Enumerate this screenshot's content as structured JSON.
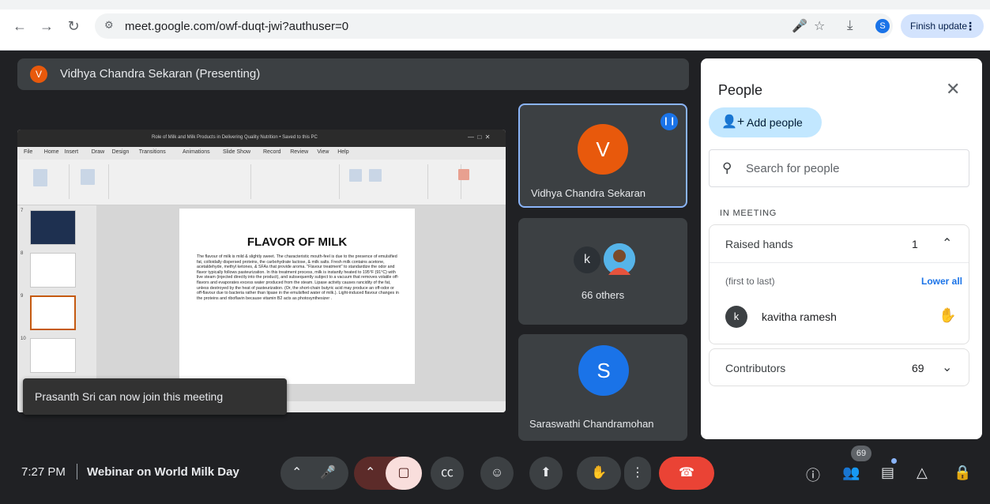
{
  "browser": {
    "url": "meet.google.com/owf-duqt-jwi?authuser=0",
    "finish_update": "Finish update",
    "profile_initial": "S"
  },
  "presenting_banner": {
    "initial": "V",
    "text": "Vidhya Chandra Sekaran (Presenting)"
  },
  "shared_screen": {
    "window_title": "Role of Milk and Milk Products in Delivering Quality Nutrition • Saved to this PC",
    "menu": [
      "File",
      "Home",
      "Insert",
      "Draw",
      "Design",
      "Transitions",
      "Animations",
      "Slide Show",
      "Record",
      "Review",
      "View",
      "Help"
    ],
    "slide_title": "FLAVOR OF MILK",
    "slide_body": "The flavour of milk is mild & slightly sweet. The characteristic mouth-feel is due to the presence of emulsified fat, colloidally dispersed proteins, the carbohydrate lactose, & milk salts. Fresh milk contains acetone, acetaldehyde, methyl ketones, & SFAs that provide aroma. \"Flavour treatment\" to standardize the odor and flavor typically follows pasteurization. In this treatment process, milk is instantly heated to 195°F (91°C) with live steam (injected directly into the product), and subsequently subject to a vacuum that removes volatile off- flavors and evaporates excess water produced from the steam. Lipase activity causes rancidity of the fat, unless destroyed by the heat of pasteurization. (Or, the short-chain butyric acid may produce an off-odor or off-flavour due to bacteria rather than lipase in the emulsified water of milk.). Light-induced flavour changes in the proteins and riboflavin because vitamin B2 acts as photosynthesizer .",
    "thumb_numbers": [
      "7",
      "8",
      "9",
      "10"
    ]
  },
  "toast": "Prasanth Sri can now join this meeting",
  "tiles": [
    {
      "initial": "V",
      "name": "Vidhya Chandra Sekaran",
      "color": "#e8590c"
    },
    {
      "initial": "k",
      "name": "66 others",
      "color": "#3c4043"
    },
    {
      "initial": "S",
      "name": "Saraswathi Chandramohan",
      "color": "#1a73e8"
    }
  ],
  "people_panel": {
    "title": "People",
    "add_people": "Add people",
    "search_placeholder": "Search for people",
    "in_meeting": "IN MEETING",
    "raised_hands": {
      "label": "Raised hands",
      "count": "1",
      "order": "(first to last)",
      "lower_all": "Lower all",
      "person": {
        "initial": "k",
        "name": "kavitha ramesh"
      }
    },
    "contributors": {
      "label": "Contributors",
      "count": "69"
    }
  },
  "bottom_bar": {
    "time": "7:27 PM",
    "meeting_name": "Webinar on World Milk Day",
    "participant_badge": "69"
  },
  "colors": {
    "accent": "#1a73e8",
    "end_call": "#ea4335",
    "background": "#202124"
  }
}
